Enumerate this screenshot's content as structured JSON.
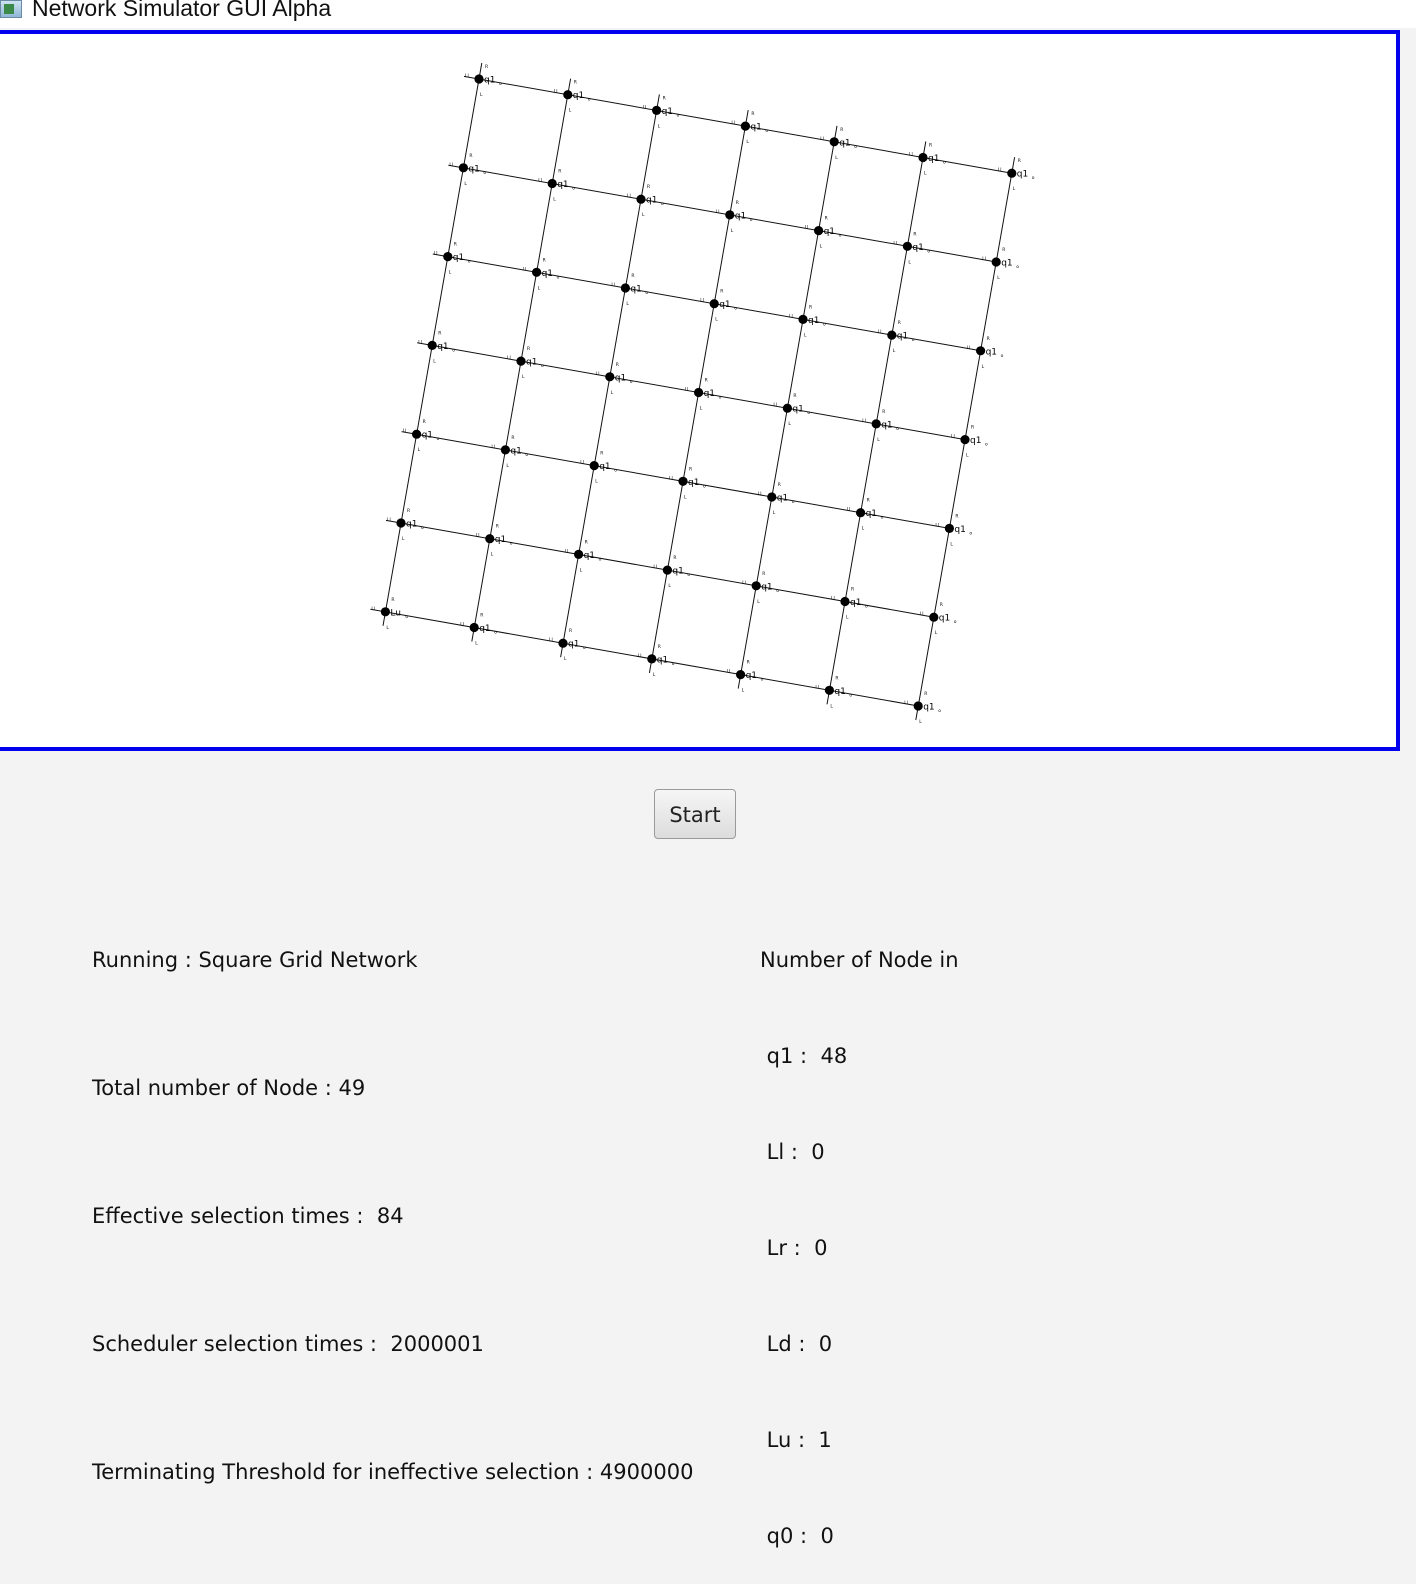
{
  "window": {
    "title": "Network Simulator GUI Alpha"
  },
  "network": {
    "grid_size": 7,
    "default_state": "q1",
    "special_node": {
      "row": 6,
      "col": 0,
      "state": "Lu"
    },
    "port_labels": {
      "left": "Ll",
      "right": "R",
      "down": "L",
      "state_sub": "o"
    },
    "colors": {
      "edge": "#111111",
      "node": "#000000"
    }
  },
  "controls": {
    "start_label": "Start"
  },
  "stats": {
    "running": "Running : Square Grid Network",
    "total_nodes": "Total number of Node : 49",
    "effective": "Effective selection times :  84",
    "scheduler": "Scheduler selection times :  2000001",
    "threshold": "Terminating Threshold for ineffective selection : 4900000"
  },
  "node_counts": {
    "header": "Number of Node in",
    "q1": " q1 :  48",
    "Ll": " Ll :  0",
    "Lr": " Lr :  0",
    "Ld": " Ld :  0",
    "Lu": " Lu :  1",
    "q0": " q0 :  0"
  },
  "colors": {
    "canvas_border": "#0000ee",
    "background": "#f3f3f3"
  }
}
